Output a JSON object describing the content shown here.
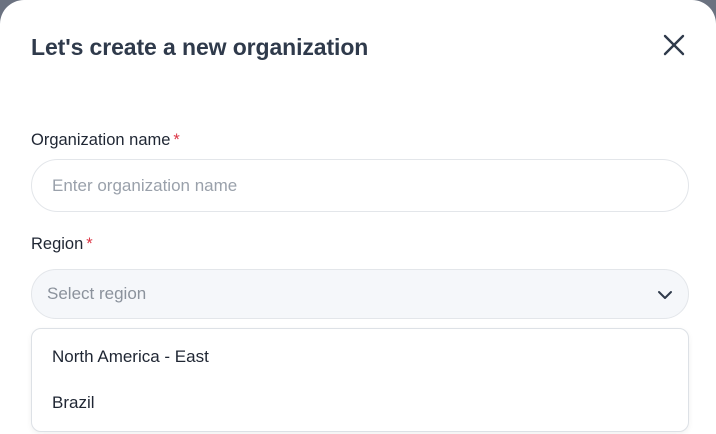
{
  "modal": {
    "title": "Let's create a new organization"
  },
  "form": {
    "org_name_label": "Organization name",
    "org_name_required": "*",
    "org_name_value": "",
    "org_name_placeholder": "Enter organization name",
    "region_label": "Region",
    "region_required": "*",
    "region_selected": "Select region",
    "region_options": [
      {
        "label": "North America - East"
      },
      {
        "label": "Brazil"
      }
    ]
  },
  "icons": {
    "close": "close-icon",
    "dropdown": "chevron-down-icon"
  },
  "colors": {
    "title": "#2f3a4b",
    "required": "#dc3545",
    "placeholder": "#9aa1ab",
    "select_bg": "#f5f7fa"
  }
}
